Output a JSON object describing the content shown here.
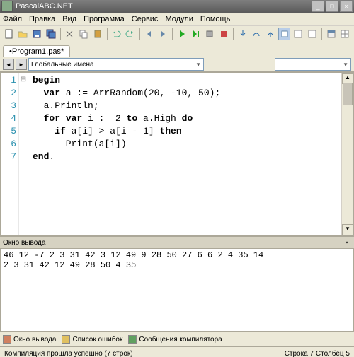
{
  "title": "PascalABC.NET",
  "window_buttons": {
    "min": "_",
    "max": "□",
    "close": "×"
  },
  "menu": [
    "Файл",
    "Правка",
    "Вид",
    "Программа",
    "Сервис",
    "Модули",
    "Помощь"
  ],
  "tab": "•Program1.pas*",
  "nav": {
    "back": "◄",
    "fwd": "►"
  },
  "combo": {
    "label": "Глобальные имена",
    "arrow": "▼"
  },
  "gutter": [
    "1",
    "2",
    "3",
    "4",
    "5",
    "6",
    "7"
  ],
  "fold": "⊟",
  "code": {
    "l1a": "begin",
    "l2a": "  ",
    "l2b": "var",
    "l2c": " a := ArrRandom(20, -10, 50);",
    "l3": "  a.Println;",
    "l4a": "  ",
    "l4b": "for var",
    "l4c": " i := 2 ",
    "l4d": "to",
    "l4e": " a.High ",
    "l4f": "do",
    "l5a": "    ",
    "l5b": "if",
    "l5c": " a[i] > a[i - 1] ",
    "l5d": "then",
    "l6": "      Print(a[i])",
    "l7a": "end",
    "l7b": "."
  },
  "output_title": "Окно вывода",
  "output_pin": "×",
  "output": "46 12 -7 2 3 31 42 3 12 49 9 28 50 27 6 6 2 4 35 14\n2 3 31 42 12 49 28 50 4 35",
  "bottom_tabs": [
    {
      "color": "#d08060",
      "label": "Окно вывода"
    },
    {
      "color": "#e0c060",
      "label": "Список ошибок"
    },
    {
      "color": "#60a060",
      "label": "Сообщения компилятора"
    }
  ],
  "status": {
    "left": "Компиляция прошла успешно (7 строк)",
    "right": "Строка 7 Столбец 5"
  }
}
